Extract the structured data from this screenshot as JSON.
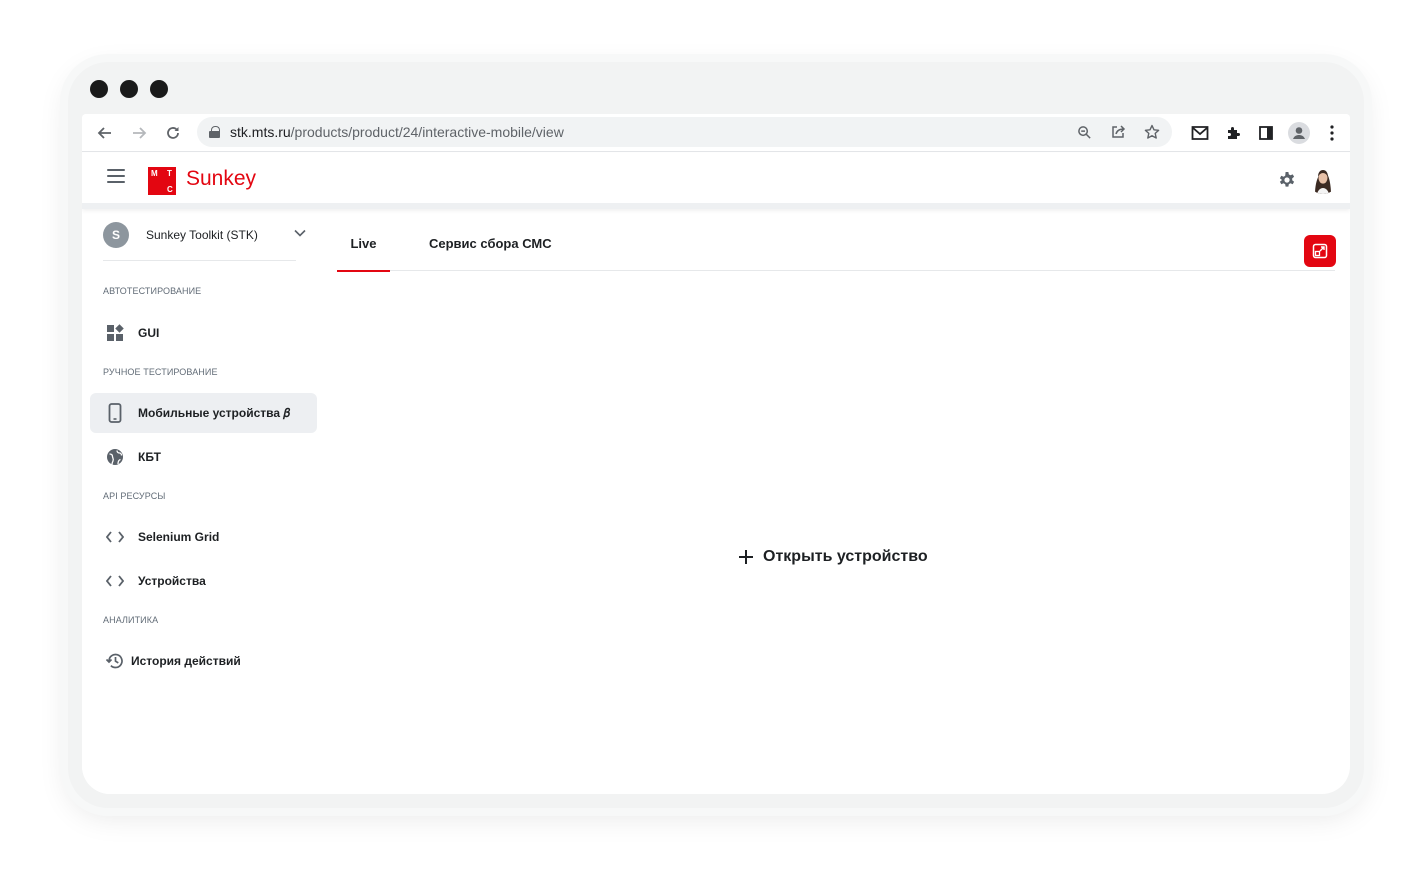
{
  "browser": {
    "url_host": "stk.mts.ru",
    "url_path": "/products/product/24/interactive-mobile/view"
  },
  "app": {
    "logo_letters": [
      "М",
      "Т",
      "С"
    ],
    "brand": "Sunkey"
  },
  "workspace": {
    "badge": "S",
    "name": "Sunkey Toolkit (STK)"
  },
  "sidebar": {
    "sections": [
      {
        "title": "АВТОТЕСТИРОВАНИЕ"
      },
      {
        "title": "РУЧНОЕ ТЕСТИРОВАНИЕ"
      },
      {
        "title": "API РЕСУРСЫ"
      },
      {
        "title": "АНАЛИТИКА"
      }
    ],
    "items": [
      {
        "label": "GUI",
        "icon": "dashboard-icon"
      },
      {
        "label": "Мобильные устройства 𝛽",
        "icon": "mobile-phone-icon",
        "active": true
      },
      {
        "label": "КБТ",
        "icon": "globe-icon"
      },
      {
        "label": "Selenium Grid",
        "icon": "code-icon"
      },
      {
        "label": "Устройства",
        "icon": "code-icon"
      },
      {
        "label": "История действий",
        "icon": "history-icon"
      }
    ]
  },
  "tabs": [
    {
      "label": "Live",
      "active": true
    },
    {
      "label": "Сервис сбора СМС",
      "active": false
    }
  ],
  "main": {
    "open_device_label": "Открыть устройство"
  },
  "colors": {
    "accent": "#e30611",
    "active_bg": "#edeff2",
    "icon_gray": "#5a6169"
  }
}
